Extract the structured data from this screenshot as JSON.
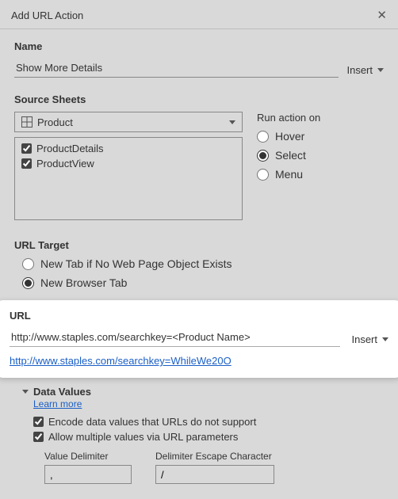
{
  "titlebar": {
    "title": "Add URL Action"
  },
  "name": {
    "label": "Name",
    "value": "Show More Details",
    "insert_label": "Insert"
  },
  "source": {
    "label": "Source Sheets",
    "selected": "Product",
    "items": [
      {
        "label": "ProductDetails",
        "checked": true
      },
      {
        "label": "ProductView",
        "checked": true
      }
    ]
  },
  "run": {
    "label": "Run action on",
    "options": [
      {
        "label": "Hover",
        "checked": false
      },
      {
        "label": "Select",
        "checked": true
      },
      {
        "label": "Menu",
        "checked": false
      }
    ]
  },
  "url_target": {
    "label": "URL Target",
    "options": [
      {
        "label": "New Tab if No Web Page Object Exists",
        "checked": false
      },
      {
        "label": "New Browser Tab",
        "checked": true
      }
    ]
  },
  "url": {
    "label": "URL",
    "value": "http://www.staples.com/searchkey=<Product Name>",
    "insert_label": "Insert",
    "preview": "http://www.staples.com/searchkey=WhileWe20O"
  },
  "data_values": {
    "label": "Data Values",
    "learn_more": "Learn more",
    "encode": {
      "label": "Encode data values that URLs do not support",
      "checked": true
    },
    "allow_multi": {
      "label": "Allow multiple values via URL parameters",
      "checked": true
    },
    "value_delimiter_label": "Value Delimiter",
    "value_delimiter": ",",
    "escape_label": "Delimiter Escape Character",
    "escape": "/"
  }
}
